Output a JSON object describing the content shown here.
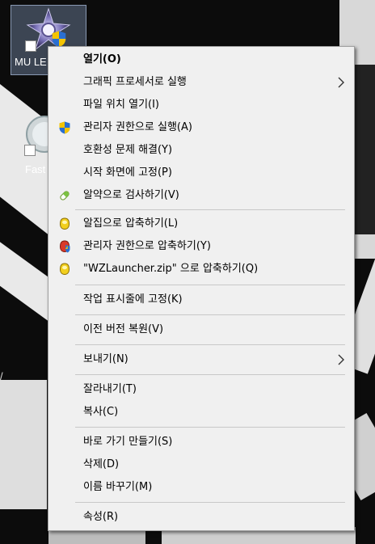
{
  "desktop": {
    "icons": [
      {
        "label": "MU LE"
      },
      {
        "label": "Fast"
      }
    ],
    "side_glyph": "/"
  },
  "context_menu": {
    "items": [
      {
        "label": "열기(O)",
        "bold": true,
        "icon": null,
        "submenu": false
      },
      {
        "label": "그래픽 프로세서로 실행",
        "icon": null,
        "submenu": true
      },
      {
        "label": "파일 위치 열기(I)",
        "icon": null,
        "submenu": false
      },
      {
        "label": "관리자 권한으로 실행(A)",
        "icon": "uac-shield-icon",
        "submenu": false
      },
      {
        "label": "호환성 문제 해결(Y)",
        "icon": null,
        "submenu": false
      },
      {
        "label": "시작 화면에 고정(P)",
        "icon": null,
        "submenu": false
      },
      {
        "label": "알약으로 검사하기(V)",
        "icon": "pill-icon",
        "submenu": false
      },
      {
        "label": "알집으로 압축하기(L)",
        "icon": "alzip-icon",
        "submenu": false
      },
      {
        "label": "관리자 권한으로 압축하기(Y)",
        "icon": "alzip-admin-icon",
        "submenu": false
      },
      {
        "label": "\"WZLauncher.zip\" 으로 압축하기(Q)",
        "icon": "alzip-icon",
        "submenu": false
      },
      {
        "label": "작업 표시줄에 고정(K)",
        "icon": null,
        "submenu": false
      },
      {
        "label": "이전 버전 복원(V)",
        "icon": null,
        "submenu": false
      },
      {
        "label": "보내기(N)",
        "icon": null,
        "submenu": true
      },
      {
        "label": "잘라내기(T)",
        "icon": null,
        "submenu": false
      },
      {
        "label": "복사(C)",
        "icon": null,
        "submenu": false
      },
      {
        "label": "바로 가기 만들기(S)",
        "icon": null,
        "submenu": false
      },
      {
        "label": "삭제(D)",
        "icon": null,
        "submenu": false
      },
      {
        "label": "이름 바꾸기(M)",
        "icon": null,
        "submenu": false
      },
      {
        "label": "속성(R)",
        "icon": null,
        "submenu": false
      }
    ]
  },
  "colors": {
    "menu_background": "#f0f0f0",
    "separator": "#c8c8c8",
    "uac_blue": "#2a6fd1",
    "uac_yellow": "#f5c400",
    "alzip_yellow": "#f2cf1e",
    "pill_green": "#7cc242"
  }
}
